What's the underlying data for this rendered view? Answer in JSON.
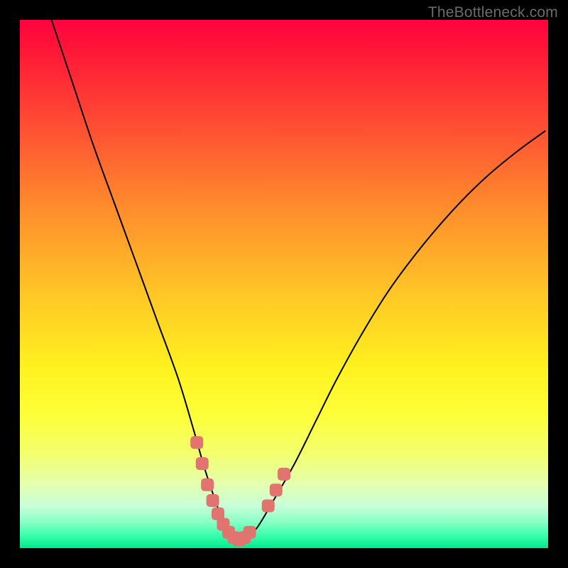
{
  "watermark": "TheBottleneck.com",
  "chart_data": {
    "type": "line",
    "title": "",
    "xlabel": "",
    "ylabel": "",
    "xlim": [
      0,
      100
    ],
    "ylim": [
      0,
      100
    ],
    "series": [
      {
        "name": "bottleneck-curve",
        "x": [
          6,
          10,
          14,
          18,
          22,
          26,
          30,
          33,
          35,
          37,
          38.5,
          40,
          41.5,
          43,
          45,
          48,
          52,
          56,
          60,
          65,
          70,
          76,
          82,
          88,
          94,
          99.5
        ],
        "values": [
          100,
          88,
          76,
          65,
          54,
          43,
          32,
          22,
          15,
          9,
          5,
          2.5,
          1.5,
          2,
          4,
          9,
          16,
          24,
          32,
          41,
          49,
          57,
          64,
          70,
          75,
          79
        ]
      }
    ],
    "markers": {
      "name": "highlight-dots",
      "color": "#e2746f",
      "points": [
        {
          "x": 33.5,
          "y": 20
        },
        {
          "x": 34.5,
          "y": 16
        },
        {
          "x": 35.5,
          "y": 12
        },
        {
          "x": 36.5,
          "y": 9
        },
        {
          "x": 37.5,
          "y": 6.5
        },
        {
          "x": 38.5,
          "y": 4.5
        },
        {
          "x": 39.5,
          "y": 3
        },
        {
          "x": 40.5,
          "y": 2
        },
        {
          "x": 41.5,
          "y": 1.5
        },
        {
          "x": 42.5,
          "y": 2
        },
        {
          "x": 43.5,
          "y": 3
        },
        {
          "x": 47.0,
          "y": 8
        },
        {
          "x": 48.5,
          "y": 11
        },
        {
          "x": 50.0,
          "y": 14
        }
      ]
    }
  }
}
